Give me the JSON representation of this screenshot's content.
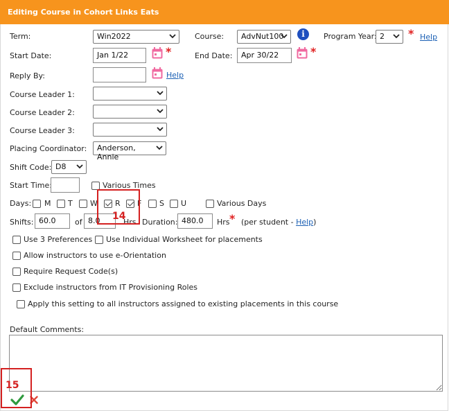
{
  "header": {
    "title": "Editing Course in Cohort Links Eats"
  },
  "term": {
    "label": "Term:",
    "value": "Win2022"
  },
  "course": {
    "label": "Course:",
    "value": "AdvNut100"
  },
  "program_year": {
    "label": "Program Year:",
    "value": "2",
    "help": "Help"
  },
  "start_date": {
    "label": "Start Date:",
    "value": "Jan 1/22"
  },
  "end_date": {
    "label": "End Date:",
    "value": "Apr 30/22"
  },
  "reply_by": {
    "label": "Reply By:",
    "value": "",
    "help": "Help"
  },
  "course_leaders": [
    {
      "label": "Course Leader 1:",
      "value": ""
    },
    {
      "label": "Course Leader 2:",
      "value": ""
    },
    {
      "label": "Course Leader 3:",
      "value": ""
    }
  ],
  "placing_coordinator": {
    "label": "Placing Coordinator:",
    "value": "Anderson, Annie"
  },
  "shift_code": {
    "label": "Shift Code:",
    "value": "D8"
  },
  "start_time": {
    "label": "Start Time:",
    "value": "",
    "various_times": "Various Times"
  },
  "days": {
    "label": "Days:",
    "items": [
      {
        "label": "M",
        "checked": false
      },
      {
        "label": "T",
        "checked": false
      },
      {
        "label": "W",
        "checked": false
      },
      {
        "label": "R",
        "checked": true
      },
      {
        "label": "F",
        "checked": true
      },
      {
        "label": "S",
        "checked": false
      },
      {
        "label": "U",
        "checked": false
      }
    ],
    "various_days": "Various Days"
  },
  "shifts": {
    "label": "Shifts:",
    "value": "60.0",
    "of": "of",
    "hours_value": "8.0",
    "hrs": "Hrs",
    "duration_label": "Duration:",
    "duration_value": "480.0",
    "duration_unit": "Hrs",
    "per_student_prefix": "(per student - ",
    "per_student_help": "Help",
    "per_student_suffix": ")"
  },
  "options": {
    "use3": "Use 3 Preferences",
    "individual_ws": "Use Individual Worksheet for placements",
    "e_orientation": "Allow instructors to use e-Orientation",
    "request_code": "Require Request Code(s)",
    "exclude_it": "Exclude instructors from IT Provisioning Roles",
    "apply_all": "Apply this setting to all instructors assigned to existing placements in this course"
  },
  "comments": {
    "label": "Default Comments:",
    "value": ""
  },
  "annotations": {
    "a14": "14",
    "a15": "15"
  },
  "colors": {
    "header": "#f7941d",
    "accent_link": "#1a5fb4",
    "required": "#e02020",
    "save": "#2e9a3e",
    "cancel": "#e0483a"
  },
  "icons": {
    "calendar": "calendar-icon",
    "info": "info-icon",
    "save": "check-icon",
    "cancel": "x-icon"
  }
}
